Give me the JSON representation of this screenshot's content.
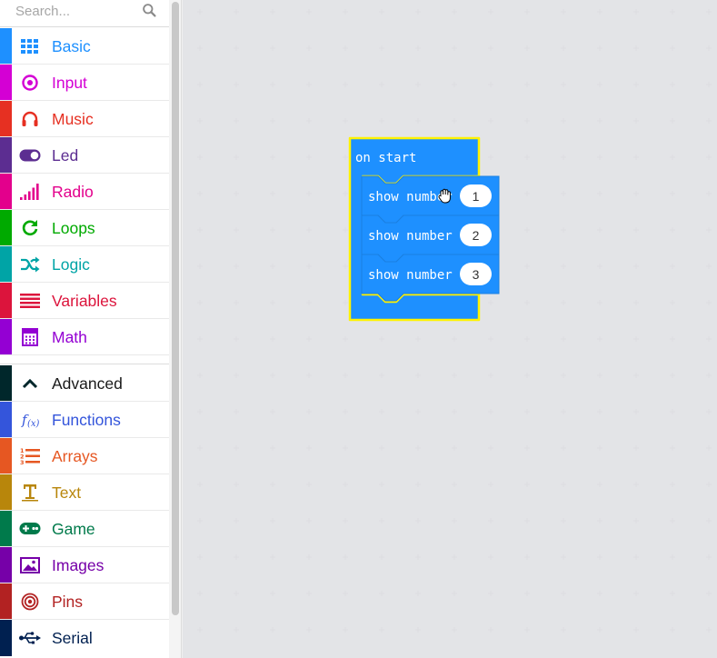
{
  "search": {
    "placeholder": "Search..."
  },
  "categories": [
    {
      "label": "Basic",
      "color": "#1e90ff",
      "icon": "grid-icon"
    },
    {
      "label": "Input",
      "color": "#d400d4",
      "icon": "target-icon"
    },
    {
      "label": "Music",
      "color": "#e63022",
      "icon": "headphones-icon"
    },
    {
      "label": "Led",
      "color": "#5c2d91",
      "icon": "toggle-icon"
    },
    {
      "label": "Radio",
      "color": "#e3008c",
      "icon": "signal-bars-icon"
    },
    {
      "label": "Loops",
      "color": "#00aa00",
      "icon": "refresh-icon"
    },
    {
      "label": "Logic",
      "color": "#00a4a6",
      "icon": "shuffle-icon"
    },
    {
      "label": "Variables",
      "color": "#dc143c",
      "icon": "lines-icon"
    },
    {
      "label": "Math",
      "color": "#9400d3",
      "icon": "calculator-icon"
    }
  ],
  "advanced": [
    {
      "label": "Advanced",
      "color": "#00272b",
      "icon": "chevron-up-icon"
    },
    {
      "label": "Functions",
      "color": "#3455db",
      "icon": "function-icon"
    },
    {
      "label": "Arrays",
      "color": "#e65722",
      "icon": "numbered-list-icon"
    },
    {
      "label": "Text",
      "color": "#b8860b",
      "icon": "text-icon"
    },
    {
      "label": "Game",
      "color": "#007a4b",
      "icon": "gamepad-icon"
    },
    {
      "label": "Images",
      "color": "#7600a8",
      "icon": "image-icon"
    },
    {
      "label": "Pins",
      "color": "#b22222",
      "icon": "bullseye-icon"
    },
    {
      "label": "Serial",
      "color": "#002050",
      "icon": "usb-icon"
    }
  ],
  "blocks": {
    "event_label": "on start",
    "statements": [
      {
        "label": "show number",
        "value": "1"
      },
      {
        "label": "show number",
        "value": "2"
      },
      {
        "label": "show number",
        "value": "3"
      }
    ],
    "block_color": "#1e90ff",
    "highlight_color": "#fff200"
  }
}
